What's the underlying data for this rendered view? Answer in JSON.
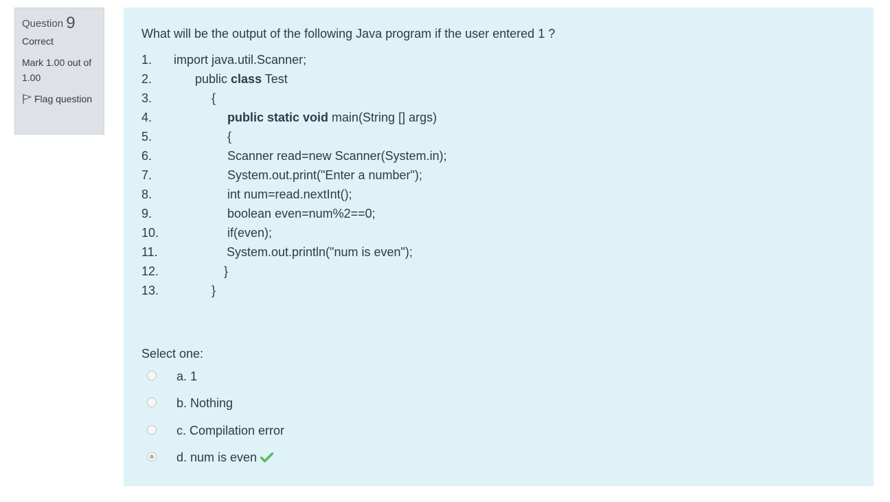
{
  "info": {
    "question_word": "Question",
    "question_number": "9",
    "state": "Correct",
    "grade": "Mark 1.00 out of 1.00",
    "flag_label": "Flag question"
  },
  "question": {
    "text": "What will be the output of the following Java program if the user entered 1 ?",
    "code_lines": [
      {
        "num": "1.",
        "pre": "import java.util.Scanner;",
        "kw": "",
        "post": ""
      },
      {
        "num": "2.",
        "pre": "public ",
        "kw": "class",
        "post": " Test"
      },
      {
        "num": "3.",
        "pre": "{",
        "kw": "",
        "post": ""
      },
      {
        "num": "4.",
        "pre": "",
        "kw": "public static void",
        "post": " main(String [] args)"
      },
      {
        "num": "5.",
        "pre": "{",
        "kw": "",
        "post": ""
      },
      {
        "num": "6.",
        "pre": "Scanner read=new Scanner(System.in);",
        "kw": "",
        "post": ""
      },
      {
        "num": "7.",
        "pre": "System.out.print(\"Enter a number\");",
        "kw": "",
        "post": ""
      },
      {
        "num": "8.",
        "pre": "int num=read.nextInt();",
        "kw": "",
        "post": ""
      },
      {
        "num": "9.",
        "pre": "boolean even=num%2==0;",
        "kw": "",
        "post": ""
      },
      {
        "num": "10.",
        "pre": "if(even);",
        "kw": "",
        "post": ""
      },
      {
        "num": "11.",
        "pre": "System.out.println(\"num is even\");",
        "kw": "",
        "post": ""
      },
      {
        "num": "12.",
        "pre": "}",
        "kw": "",
        "post": ""
      },
      {
        "num": "13.",
        "pre": "}",
        "kw": "",
        "post": ""
      }
    ],
    "prompt": "Select one:",
    "answers": [
      {
        "label": "a. 1",
        "checked": false,
        "correct": false
      },
      {
        "label": "b. Nothing",
        "checked": false,
        "correct": false
      },
      {
        "label": "c. Compilation error",
        "checked": false,
        "correct": false
      },
      {
        "label": "d. num is even",
        "checked": true,
        "correct": true
      }
    ]
  },
  "colors": {
    "info_background": "#dee2e6",
    "content_background": "#def2f8",
    "correct_check": "#5cb85c"
  },
  "icons": {
    "flag": "flag-icon",
    "correct": "check-icon"
  }
}
